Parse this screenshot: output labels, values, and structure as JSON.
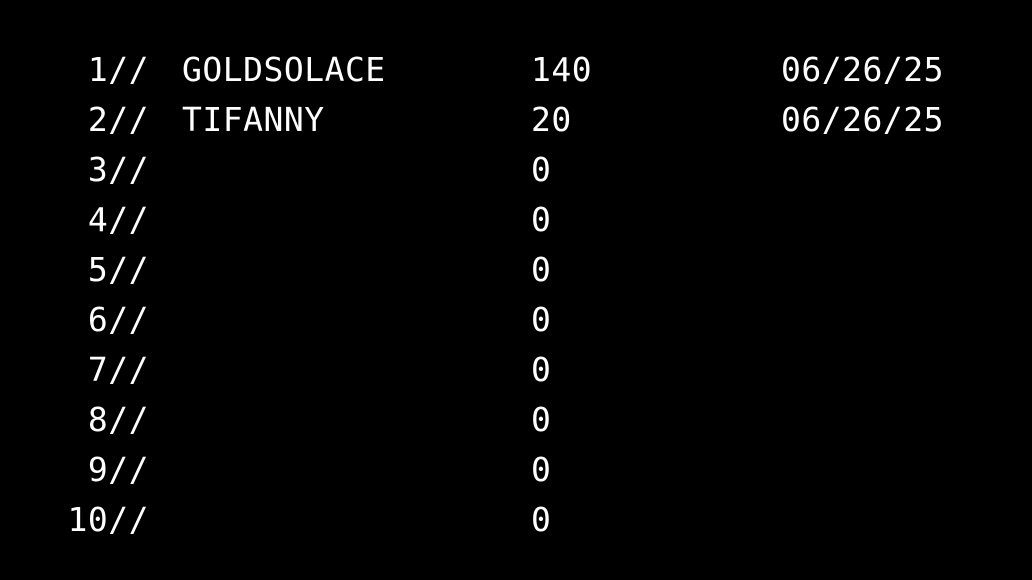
{
  "leaderboard": {
    "rows": [
      {
        "rank": "1//",
        "name": "GOLDSOLACE",
        "score": "140",
        "date": "06/26/25"
      },
      {
        "rank": "2//",
        "name": "TIFANNY",
        "score": "20",
        "date": "06/26/25"
      },
      {
        "rank": "3//",
        "name": "",
        "score": "0",
        "date": ""
      },
      {
        "rank": "4//",
        "name": "",
        "score": "0",
        "date": ""
      },
      {
        "rank": "5//",
        "name": "",
        "score": "0",
        "date": ""
      },
      {
        "rank": "6//",
        "name": "",
        "score": "0",
        "date": ""
      },
      {
        "rank": "7//",
        "name": "",
        "score": "0",
        "date": ""
      },
      {
        "rank": "8//",
        "name": "",
        "score": "0",
        "date": ""
      },
      {
        "rank": "9//",
        "name": "",
        "score": "0",
        "date": ""
      },
      {
        "rank": "10//",
        "name": "",
        "score": "0",
        "date": ""
      }
    ]
  },
  "colors": {
    "background": "#000000",
    "text": "#ffffff"
  }
}
